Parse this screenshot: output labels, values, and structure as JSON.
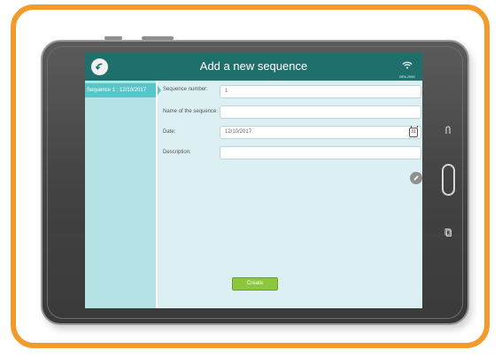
{
  "app": {
    "title": "Add a new sequence",
    "wifi_label": "BPA 2990"
  },
  "sidebar": {
    "items": [
      {
        "label": "Sequence 1 : 12/10/2017",
        "selected": true
      }
    ]
  },
  "form": {
    "sequence_number": {
      "label": "Sequence number:",
      "value": "1"
    },
    "name": {
      "label": "Name of the sequence:",
      "value": ""
    },
    "date": {
      "label": "Date:",
      "value": "12/10/2017",
      "calendar_day": "31"
    },
    "description": {
      "label": "Description:",
      "value": ""
    },
    "create_label": "Create"
  },
  "icons": {
    "back": "back-arrow-icon",
    "wifi": "wifi-icon",
    "calendar": "calendar-icon",
    "edit": "pencil-icon",
    "back_nav": "back-nav-icon",
    "recent_apps": "recent-apps-icon"
  },
  "colors": {
    "frame": "#f39a2b",
    "topbar": "#1f6f6c",
    "sidebar": "#b4e2e5",
    "selected_item": "#58c6c8",
    "content_bg": "#dceff2",
    "create_button": "#8dc63f"
  }
}
